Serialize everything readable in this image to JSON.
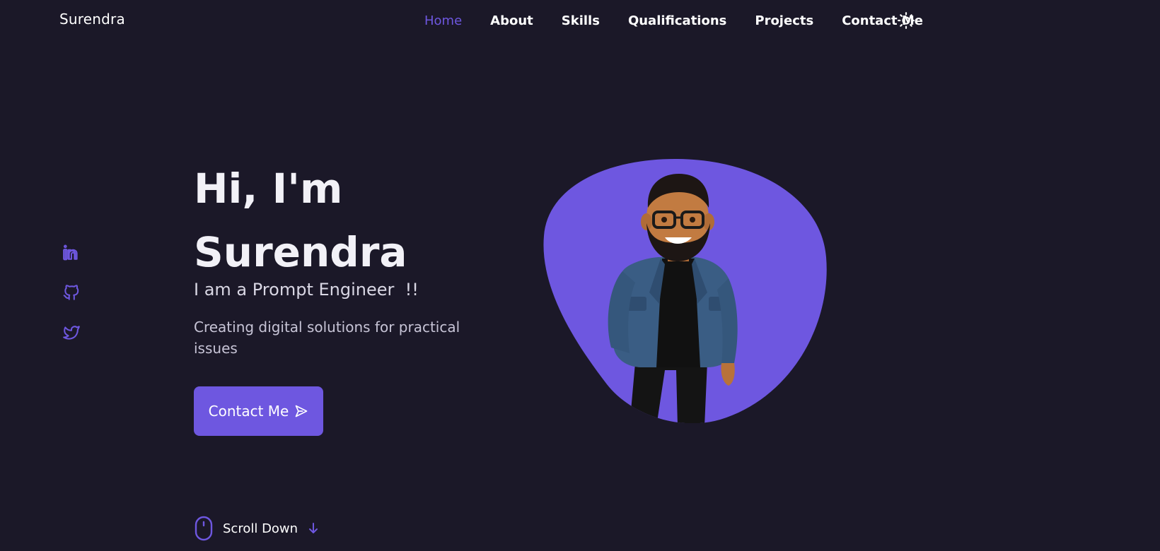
{
  "header": {
    "brand": "Surendra",
    "nav": [
      "Home",
      "About",
      "Skills",
      "Qualifications",
      "Projects",
      "Contact Me"
    ],
    "active_nav": "Home",
    "theme_icon": "sun-icon"
  },
  "social": {
    "icons": [
      "linkedin-icon",
      "github-icon",
      "twitter-icon"
    ]
  },
  "hero": {
    "title_line1": "Hi, I'm",
    "title_line2": "Surendra",
    "subtitle": "I am a Prompt Engineer  !!",
    "description": "Creating digital solutions for practical issues",
    "cta_label": "Contact Me",
    "cta_icon": "send-icon"
  },
  "scroll": {
    "label": "Scroll Down",
    "mouse_icon": "mouse-icon",
    "arrow_icon": "arrow-down-icon"
  },
  "colors": {
    "background": "#1b1828",
    "accent": "#6e57e0",
    "text": "#ffffff"
  }
}
